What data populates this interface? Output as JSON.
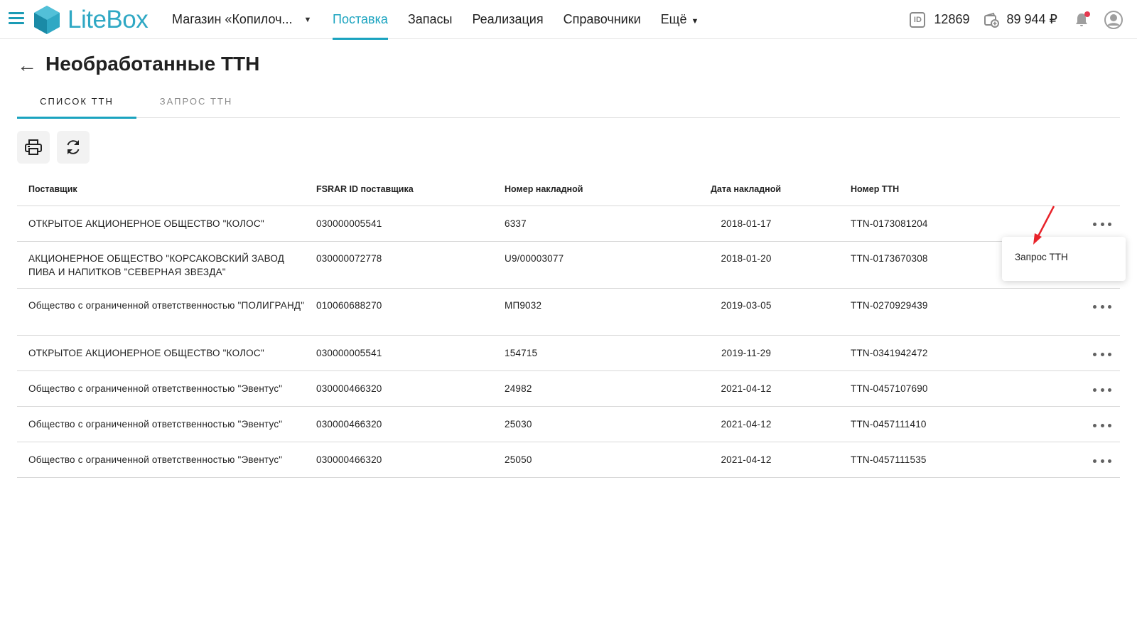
{
  "header": {
    "logo_text": "LiteBox",
    "store_name": "Магазин «Копилоч...",
    "nav": [
      {
        "label": "Поставка",
        "active": true
      },
      {
        "label": "Запасы",
        "active": false
      },
      {
        "label": "Реализация",
        "active": false
      },
      {
        "label": "Справочники",
        "active": false
      },
      {
        "label": "Ещё",
        "active": false
      }
    ],
    "id_icon_text": "ID",
    "id_value": "12869",
    "balance": "89 944 ₽",
    "accent_color": "#1aa3bf",
    "notification_color": "#e53950"
  },
  "page": {
    "title": "Необработанные ТТН",
    "tabs": [
      {
        "label": "СПИСОК ТТН",
        "active": true
      },
      {
        "label": "ЗАПРОС ТТН",
        "active": false
      }
    ]
  },
  "table": {
    "columns": [
      "Поставщик",
      "FSRAR ID поставщика",
      "Номер накладной",
      "Дата накладной",
      "Номер ТТН"
    ],
    "rows": [
      {
        "supplier": "ОТКРЫТОЕ АКЦИОНЕРНОЕ ОБЩЕСТВО \"КОЛОС\"",
        "fsrar": "030000005541",
        "invoice": "6337",
        "date": "2018-01-17",
        "ttn": "TTN-0173081204"
      },
      {
        "supplier": "АКЦИОНЕРНОЕ ОБЩЕСТВО \"КОРСАКОВСКИЙ ЗАВОД ПИВА И НАПИТКОВ \"СЕВЕРНАЯ ЗВЕЗДА\"",
        "fsrar": "030000072778",
        "invoice": "U9/00003077",
        "date": "2018-01-20",
        "ttn": "TTN-0173670308"
      },
      {
        "supplier": "Общество с ограниченной ответственностью \"ПОЛИГРАНД\"",
        "fsrar": "010060688270",
        "invoice": "МП9032",
        "date": "2019-03-05",
        "ttn": "TTN-0270929439"
      },
      {
        "supplier": "ОТКРЫТОЕ АКЦИОНЕРНОЕ ОБЩЕСТВО \"КОЛОС\"",
        "fsrar": "030000005541",
        "invoice": "154715",
        "date": "2019-11-29",
        "ttn": "TTN-0341942472"
      },
      {
        "supplier": "Общество с ограниченной ответственностью \"Эвентус\"",
        "fsrar": "030000466320",
        "invoice": "24982",
        "date": "2021-04-12",
        "ttn": "TTN-0457107690"
      },
      {
        "supplier": "Общество с ограниченной ответственностью \"Эвентус\"",
        "fsrar": "030000466320",
        "invoice": "25030",
        "date": "2021-04-12",
        "ttn": "TTN-0457111410"
      },
      {
        "supplier": "Общество с ограниченной ответственностью \"Эвентус\"",
        "fsrar": "030000466320",
        "invoice": "25050",
        "date": "2021-04-12",
        "ttn": "TTN-0457111535"
      }
    ]
  },
  "dropdown": {
    "items": [
      "Запрос ТТН"
    ]
  },
  "icons": {
    "menu": "hamburger-menu-icon",
    "print": "printer-icon",
    "refresh": "refresh-icon",
    "more": "more-horizontal-icon",
    "back": "back-arrow-icon",
    "bell": "bell-icon",
    "avatar": "user-avatar-icon",
    "wallet": "wallet-icon",
    "annotation": "red-arrow-icon",
    "annotation_color": "#e8232a"
  }
}
